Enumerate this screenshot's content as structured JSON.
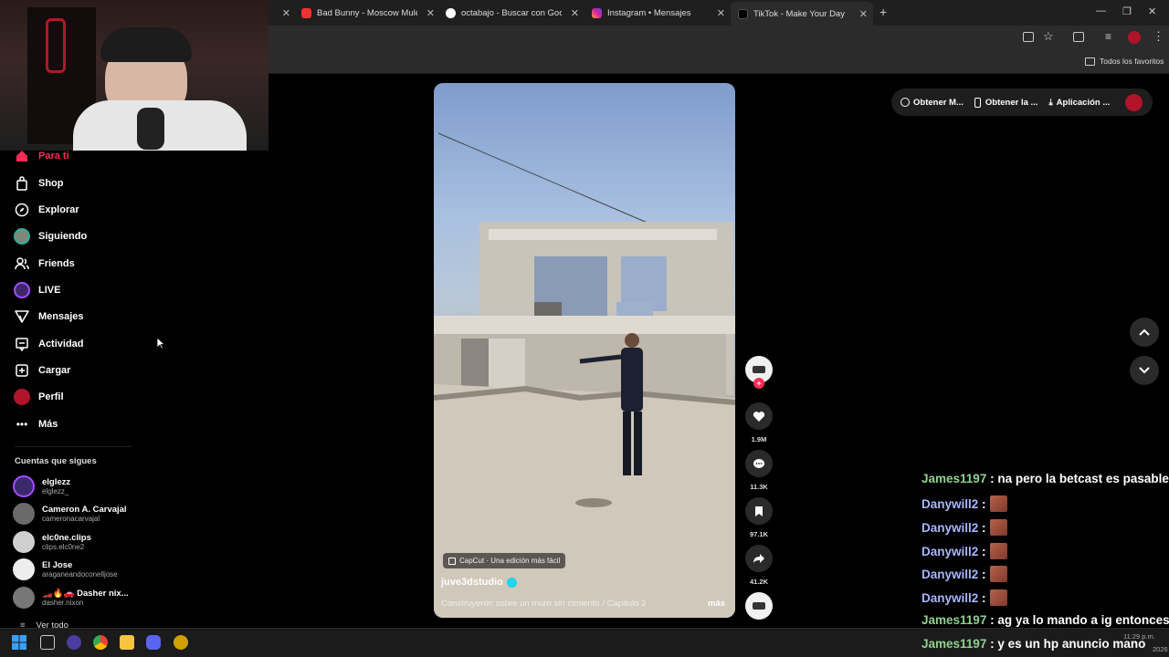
{
  "browser": {
    "tabs": [
      {
        "title": "Bad Bunny - Moscow Mule (Vid",
        "color": "#e33"
      },
      {
        "title": "octabajo - Buscar con Google",
        "color": "#4285f4"
      },
      {
        "title": "Instagram • Mensajes",
        "color": "#d6249f"
      },
      {
        "title": "TikTok - Make Your Day",
        "color": "#111"
      }
    ],
    "new_tab": "+",
    "bookmarks_folder": "Todos los favoritos"
  },
  "sidebar": {
    "nav": [
      {
        "label": "Para ti",
        "icon": "home-icon"
      },
      {
        "label": "Shop",
        "icon": "shop-icon"
      },
      {
        "label": "Explorar",
        "icon": "compass-icon"
      },
      {
        "label": "Siguiendo",
        "icon": "following-avatar-icon"
      },
      {
        "label": "Friends",
        "icon": "friends-icon"
      },
      {
        "label": "LIVE",
        "icon": "live-icon"
      },
      {
        "label": "Mensajes",
        "icon": "send-icon"
      },
      {
        "label": "Actividad",
        "icon": "activity-icon"
      },
      {
        "label": "Cargar",
        "icon": "upload-icon"
      },
      {
        "label": "Perfil",
        "icon": "profile-avatar-icon"
      },
      {
        "label": "Más",
        "icon": "more-dots-icon"
      }
    ],
    "following_title": "Cuentas que sigues",
    "accounts": [
      {
        "name": "elglezz",
        "handle": "elglezz_"
      },
      {
        "name": "Cameron A. Carvajal",
        "handle": "cameronacarvajal"
      },
      {
        "name": "elc0ne.clips",
        "handle": "clips.elc0ne2"
      },
      {
        "name": "El Jose",
        "handle": "araganeandoconelljose"
      },
      {
        "name": "🏎️🔥🚗 Dasher nix...",
        "handle": "dasher.nixon"
      }
    ],
    "see_all": "Ver todo"
  },
  "top_actions": [
    {
      "label": "Obtener M..."
    },
    {
      "label": "Obtener la ..."
    },
    {
      "label": "Aplicación ..."
    }
  ],
  "video": {
    "capcut_label": "CapCut · Una edición más fácil",
    "author": "juve3dstudio",
    "caption": "Construyeron sobre un muro sin cimiento / Capitulo 2",
    "more": "más"
  },
  "actions": {
    "likes": "1.9M",
    "comments": "11.3K",
    "saves": "97.1K",
    "shares": "41.2K"
  },
  "chat": [
    {
      "user": "James1197",
      "color": "green",
      "text": ": na pero la betcast es pasable",
      "emote": false
    },
    {
      "user": "Danywill2",
      "color": "blue",
      "text": ":",
      "emote": true
    },
    {
      "user": "Danywill2",
      "color": "blue",
      "text": ":",
      "emote": true
    },
    {
      "user": "Danywill2",
      "color": "blue",
      "text": ":",
      "emote": true
    },
    {
      "user": "Danywill2",
      "color": "blue",
      "text": ":",
      "emote": true
    },
    {
      "user": "Danywill2",
      "color": "blue",
      "text": ":",
      "emote": true
    },
    {
      "user": "James1197",
      "color": "green",
      "text": ": ag ya lo mando a ig entonces",
      "emote": false
    },
    {
      "user": "James1197",
      "color": "green",
      "text": ": y es un hp anuncio mano",
      "emote": false
    }
  ],
  "taskbar": {
    "time": "11:29 p.m.",
    "date": "2026"
  }
}
